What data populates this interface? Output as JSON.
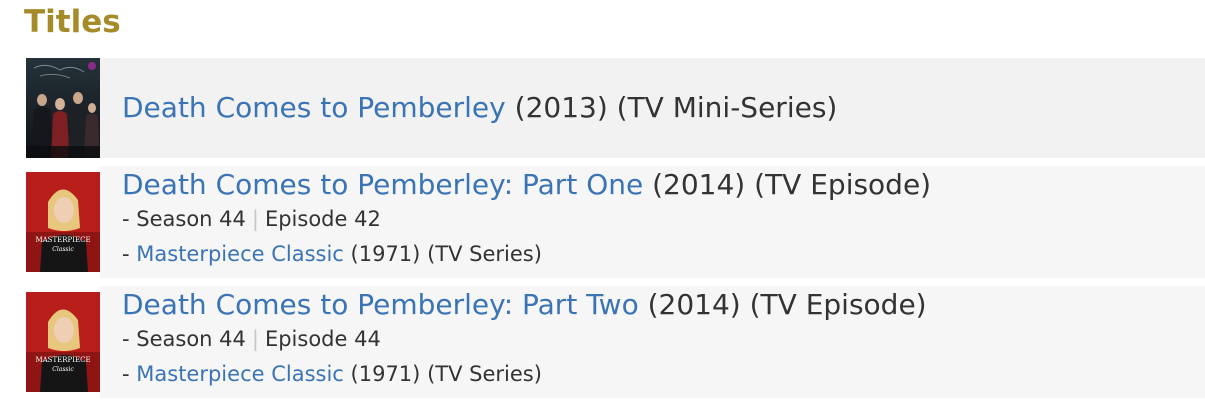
{
  "section": {
    "title": "Titles"
  },
  "results": [
    {
      "title": "Death Comes to Pemberley",
      "year": "(2013)",
      "type": "(TV Mini-Series)",
      "thumb": "mini-series-poster"
    },
    {
      "title": "Death Comes to Pemberley: Part One",
      "year": "(2014)",
      "type": "(TV Episode)",
      "season": "- Season 44",
      "sep": "|",
      "episode": "Episode 42",
      "series_prefix": "- ",
      "series": "Masterpiece Classic",
      "series_year": "(1971)",
      "series_type": "(TV Series)",
      "thumb": "masterpiece-classic-poster"
    },
    {
      "title": "Death Comes to Pemberley: Part Two",
      "year": "(2014)",
      "type": "(TV Episode)",
      "season": "- Season 44",
      "sep": "|",
      "episode": "Episode 44",
      "series_prefix": "- ",
      "series": "Masterpiece Classic",
      "series_year": "(1971)",
      "series_type": "(TV Series)",
      "thumb": "masterpiece-classic-poster"
    }
  ],
  "poster_text": {
    "masterpiece": "MASTERPIECE",
    "classic": "Classic"
  },
  "colors": {
    "heading": "#a58b2a",
    "link": "#3a74b5",
    "text": "#333333",
    "row_bg": "#f4f4f4"
  }
}
